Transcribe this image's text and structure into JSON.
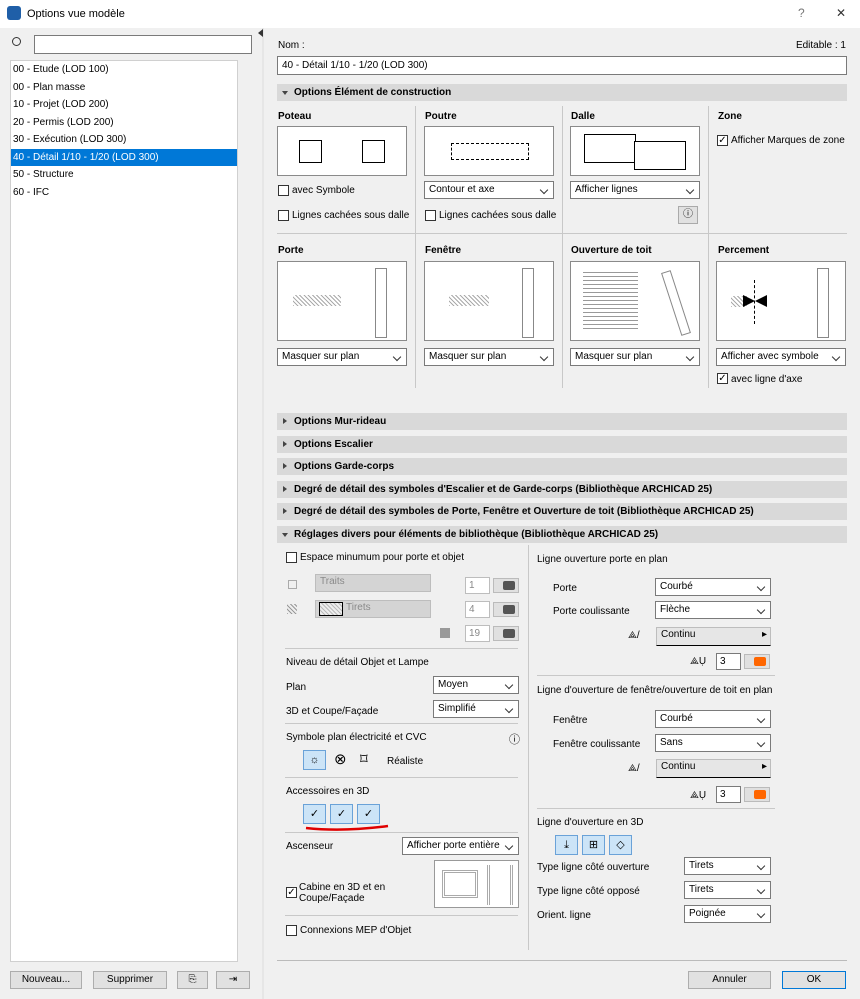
{
  "window": {
    "title": "Options vue modèle",
    "help": "?",
    "close": "✕"
  },
  "left": {
    "items": [
      "00 - Etude (LOD 100)",
      "00 - Plan masse",
      "10 - Projet (LOD 200)",
      "20 - Permis (LOD 200)",
      "30 - Exécution (LOD 300)",
      "40 - Détail 1/10 - 1/20 (LOD 300)",
      "50 - Structure",
      "60 - IFC"
    ],
    "selected": 5,
    "new_label": "Nouveau...",
    "delete_label": "Supprimer"
  },
  "name": {
    "label": "Nom :",
    "value": "40 - Détail 1/10 - 1/20 (LOD 300)",
    "editable": "Editable : 1"
  },
  "sections": {
    "construction": "Options Élément de construction",
    "mur": "Options Mur-rideau",
    "escalier": "Options Escalier",
    "garde": "Options Garde-corps",
    "deg1": "Degré de détail des symboles d'Escalier et de Garde-corps (Bibliothèque ARCHICAD 25)",
    "deg2": "Degré de détail des symboles de Porte, Fenêtre et Ouverture de toit (Bibliothèque ARCHICAD 25)",
    "divers": "Réglages divers pour éléments de bibliothèque (Bibliothèque ARCHICAD 25)"
  },
  "elements": {
    "poteau": {
      "title": "Poteau",
      "cb1": "avec Symbole",
      "cb2": "Lignes cachées sous dalle"
    },
    "poutre": {
      "title": "Poutre",
      "select": "Contour et axe",
      "cb2": "Lignes cachées sous dalle"
    },
    "dalle": {
      "title": "Dalle",
      "select": "Afficher lignes"
    },
    "zone": {
      "title": "Zone",
      "cb": "Afficher Marques de zone"
    },
    "porte": {
      "title": "Porte",
      "select": "Masquer sur plan"
    },
    "fenetre": {
      "title": "Fenêtre",
      "select": "Masquer sur plan"
    },
    "toit": {
      "title": "Ouverture de toit",
      "select": "Masquer sur plan"
    },
    "percement": {
      "title": "Percement",
      "select": "Afficher avec symbole",
      "cb": "avec ligne d'axe"
    }
  },
  "divers": {
    "espace": "Espace minumum pour porte et objet",
    "traits": "Traits",
    "tirets": "Tirets",
    "pen1": "1",
    "pen2": "4",
    "pen3": "19",
    "niveau": "Niveau de détail Objet et Lampe",
    "plan_label": "Plan",
    "plan_value": "Moyen",
    "coupe_label": "3D et Coupe/Façade",
    "coupe_value": "Simplifié",
    "symbole": "Symbole plan électricité et CVC",
    "realiste": "Réaliste",
    "accessoires": "Accessoires en 3D",
    "ascenseur_label": "Ascenseur",
    "ascenseur_value": "Afficher porte entière",
    "cabine": "Cabine en 3D et en Coupe/Façade",
    "mep": "Connexions MEP d'Objet",
    "porte_plan": "Ligne ouverture porte en plan",
    "porte_label": "Porte",
    "porte_value": "Courbé",
    "coul_label": "Porte coulissante",
    "coul_value": "Flèche",
    "line1": "Continu",
    "pen_a": "3",
    "fen_plan": "Ligne d'ouverture de fenêtre/ouverture de toit en plan",
    "fen_label": "Fenêtre",
    "fen_value": "Courbé",
    "fcoul_label": "Fenêtre coulissante",
    "fcoul_value": "Sans",
    "line2": "Continu",
    "pen_b": "3",
    "ouv3d": "Ligne d'ouverture en 3D",
    "type_ouv_label": "Type ligne côté ouverture",
    "type_ouv_value": "Tirets",
    "type_opp_label": "Type ligne côté opposé",
    "type_opp_value": "Tirets",
    "orient_label": "Orient. ligne",
    "orient_value": "Poignée"
  },
  "footer": {
    "cancel": "Annuler",
    "ok": "OK"
  },
  "colors": {
    "accent": "#0078d7",
    "pen_orange": "#ff6600",
    "underline": "#e00000"
  }
}
